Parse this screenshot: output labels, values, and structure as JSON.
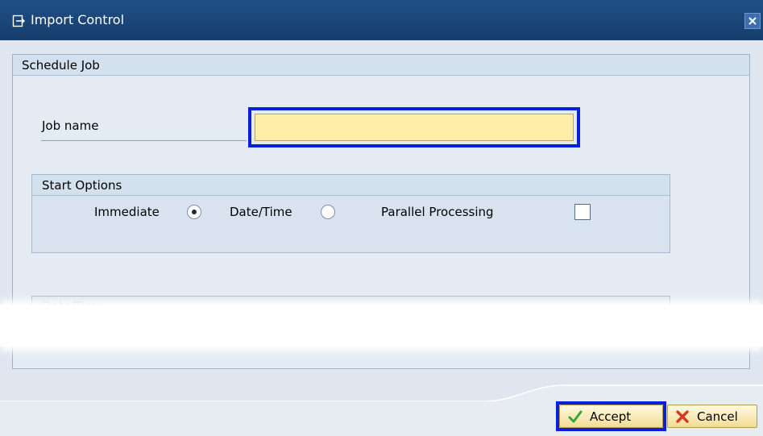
{
  "window": {
    "title": "Import Control",
    "title_icon": "transfer-icon",
    "close_icon": "close-icon"
  },
  "schedule_job": {
    "title": "Schedule Job",
    "job_name": {
      "label": "Job name",
      "value": "",
      "placeholder": ""
    },
    "start_options": {
      "title": "Start Options",
      "immediate_label": "Immediate",
      "immediate_checked": true,
      "datetime_label": "Date/Time",
      "datetime_checked": false,
      "parallel_label": "Parallel Processing",
      "parallel_checked": false
    },
    "datetime_section": {
      "title": "Date/Time"
    }
  },
  "footer": {
    "accept_label": "Accept",
    "cancel_label": "Cancel"
  },
  "colors": {
    "titlebar": "#1f4f86",
    "input_bg": "#ffeea8",
    "focus_frame": "#0a1fd9",
    "button_bg": "#f2dc95",
    "accept_check": "#3aa63a",
    "cancel_x": "#d43a1f"
  }
}
